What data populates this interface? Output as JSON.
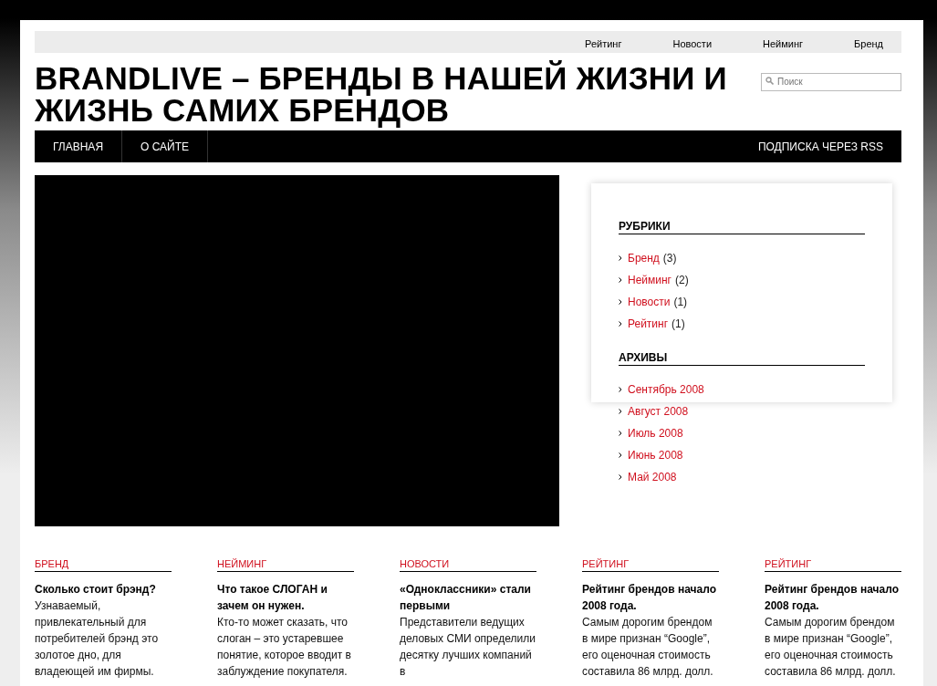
{
  "top_links": [
    "Рейтинг",
    "Новости",
    "Нейминг",
    "Бренд"
  ],
  "site_title": "BRANDLIVE – БРЕНДЫ В НАШЕЙ ЖИЗНИ И ЖИЗНЬ САМИХ БРЕНДОВ",
  "search": {
    "placeholder": "Поиск"
  },
  "nav": {
    "items": [
      "ГЛАВНАЯ",
      "О САЙТЕ"
    ],
    "rss": "ПОДПИСКА ЧЕРЕЗ RSS"
  },
  "sidebar": {
    "sections": [
      {
        "title": "РУБРИКИ",
        "items": [
          {
            "label": "Бренд",
            "count": "(3)"
          },
          {
            "label": "Нейминг",
            "count": "(2)"
          },
          {
            "label": "Новости",
            "count": "(1)"
          },
          {
            "label": "Рейтинг",
            "count": "(1)"
          }
        ]
      },
      {
        "title": "АРХИВЫ",
        "items": [
          {
            "label": "Сентябрь 2008"
          },
          {
            "label": "Август 2008"
          },
          {
            "label": "Июль 2008"
          },
          {
            "label": "Июнь 2008"
          },
          {
            "label": "Май 2008"
          }
        ]
      }
    ]
  },
  "posts": [
    {
      "category": "БРЕНД",
      "title": "Сколько стоит брэнд?",
      "excerpt": "Узнаваемый, привлекательный для потребителей брэнд это золотое дно, для владеющей им фирмы."
    },
    {
      "category": "НЕЙМИНГ",
      "title": "Что такое СЛОГАН и зачем он нужен.",
      "excerpt": "Кто-то может сказать, что слоган – это устаревшее понятие, которое вводит в заблуждение покупателя."
    },
    {
      "category": "НОВОСТИ",
      "title": "«Одноклассники» стали первыми",
      "excerpt": "Представители ведущих деловых СМИ определили десятку лучших компаний в"
    },
    {
      "category": "РЕЙТИНГ",
      "title": "Рейтинг брендов начало 2008 года.",
      "excerpt": "Самым дорогим брендом в мире признан “Google”, его оценочная стоимость составила 86 млрд. долл."
    },
    {
      "category": "РЕЙТИНГ",
      "title": "Рейтинг брендов начало 2008 года.",
      "excerpt": "Самым дорогим брендом в мире признан “Google”, его оценочная стоимость составила 86 млрд. долл."
    }
  ]
}
